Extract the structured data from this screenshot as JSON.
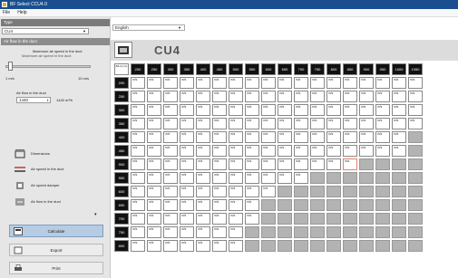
{
  "window": {
    "title": "BF Select CCU4.0"
  },
  "menu": [
    "File",
    "Help"
  ],
  "sidebar": {
    "type_header": "Type",
    "type_value": "CU4",
    "flow_header": "Air flow in the duct",
    "max_speed_label": "Maximum air speed in the duct",
    "max_speed_sub": "Maximum air speed in the duct",
    "slider_min": "1 m/s",
    "slider_max": "10 m/s",
    "flow_label": "Air flow in the duct",
    "flow_value": "1440",
    "flow_unit": "1440 m³/h",
    "items": [
      {
        "label": "Dimensions"
      },
      {
        "label": "Air speed in the duct"
      },
      {
        "label": "Air speed damper"
      },
      {
        "label": "Air flow in the duct"
      }
    ],
    "buttons": [
      {
        "label": "Calculate"
      },
      {
        "label": "Export"
      },
      {
        "label": "Print"
      }
    ]
  },
  "main": {
    "language": "English",
    "model_name": "CU4",
    "corner_label": "B/H (mm)",
    "columns": [
      "200",
      "250",
      "300",
      "350",
      "400",
      "450",
      "500",
      "550",
      "600",
      "650",
      "700",
      "750",
      "800",
      "850",
      "900",
      "950",
      "1000",
      "1050"
    ],
    "rows": [
      "200",
      "250",
      "300",
      "350",
      "400",
      "450",
      "500",
      "550",
      "600",
      "650",
      "700",
      "750",
      "800"
    ],
    "filled_counts": [
      18,
      18,
      18,
      18,
      17,
      17,
      14,
      11,
      9,
      8,
      8,
      7,
      7
    ],
    "highlight": {
      "row": 6,
      "col": 13
    },
    "cell_unit": "m/s"
  }
}
